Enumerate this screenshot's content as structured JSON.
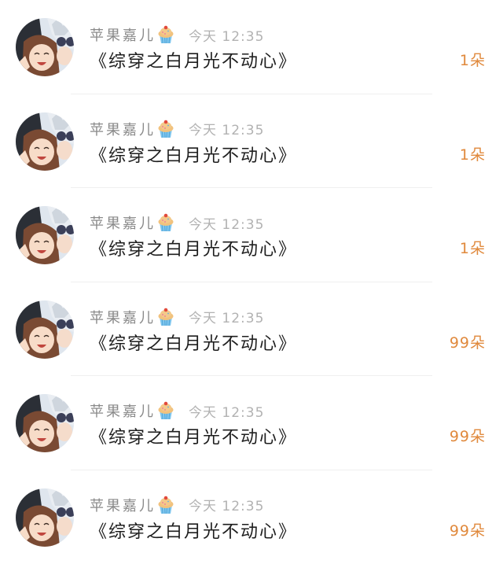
{
  "records": [
    {
      "user_name": "苹果嘉儿",
      "badge_icon": "cupcake-icon",
      "time": "今天 12:35",
      "book_title": "《综穿之白月光不动心》",
      "count": "1朵"
    },
    {
      "user_name": "苹果嘉儿",
      "badge_icon": "cupcake-icon",
      "time": "今天 12:35",
      "book_title": "《综穿之白月光不动心》",
      "count": "1朵"
    },
    {
      "user_name": "苹果嘉儿",
      "badge_icon": "cupcake-icon",
      "time": "今天 12:35",
      "book_title": "《综穿之白月光不动心》",
      "count": "1朵"
    },
    {
      "user_name": "苹果嘉儿",
      "badge_icon": "cupcake-icon",
      "time": "今天 12:35",
      "book_title": "《综穿之白月光不动心》",
      "count": "99朵"
    },
    {
      "user_name": "苹果嘉儿",
      "badge_icon": "cupcake-icon",
      "time": "今天 12:35",
      "book_title": "《综穿之白月光不动心》",
      "count": "99朵"
    },
    {
      "user_name": "苹果嘉儿",
      "badge_icon": "cupcake-icon",
      "time": "今天 12:35",
      "book_title": "《综穿之白月光不动心》",
      "count": "99朵"
    }
  ],
  "colors": {
    "count": "#e0893c",
    "name": "#8a8a8a",
    "time": "#b2b2b2",
    "title": "#1e1e1e"
  }
}
